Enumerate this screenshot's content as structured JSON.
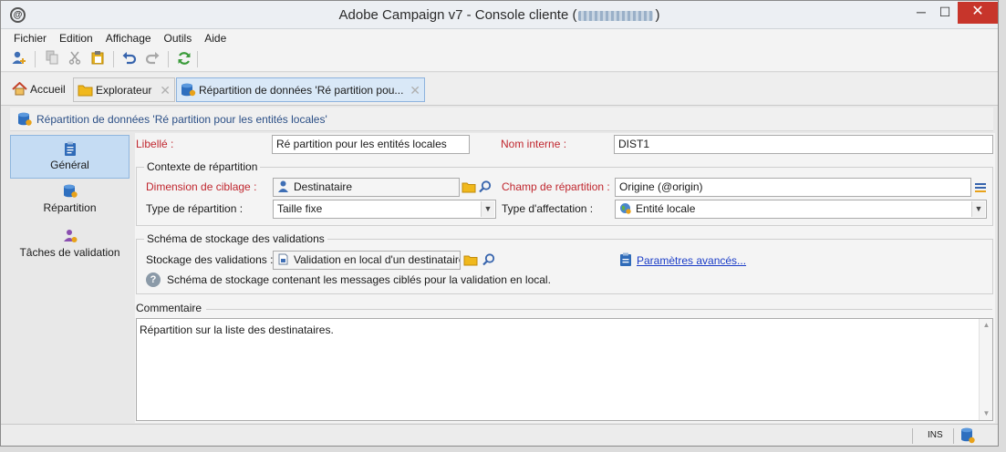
{
  "window": {
    "title_prefix": "Adobe Campaign v7 - Console cliente (",
    "title_suffix": ")",
    "controls": {
      "minimize": "─",
      "maximize": "☐",
      "close": "✕"
    }
  },
  "menu": [
    "Fichier",
    "Edition",
    "Affichage",
    "Outils",
    "Aide"
  ],
  "toolbar": {
    "icons": [
      "new-user-icon",
      "copy-icon",
      "cut-icon",
      "paste-icon",
      "undo-icon",
      "redo-icon",
      "refresh-icon"
    ]
  },
  "tabs": [
    {
      "label": "Accueil",
      "icon": "home-icon"
    },
    {
      "label": "Explorateur",
      "icon": "folder-icon",
      "close": "✕"
    },
    {
      "label": "Répartition de données 'Ré partition pou...",
      "icon": "database-icon",
      "close": "✕"
    }
  ],
  "breadcrumb": "Répartition de données 'Ré partition pour les entités locales'",
  "nav": {
    "general": "Général",
    "repartition": "Répartition",
    "taches": "Tâches de validation"
  },
  "form": {
    "libelle_label": "Libellé :",
    "libelle_value": "Ré partition pour les entités locales",
    "nom_interne_label": "Nom interne :",
    "nom_interne_value": "DIST1",
    "contexte_title": "Contexte de répartition",
    "dimension_label": "Dimension de ciblage :",
    "dimension_value": "Destinataire",
    "champ_label": "Champ de répartition :",
    "champ_value": "Origine (@origin)",
    "type_rep_label": "Type de répartition :",
    "type_rep_value": "Taille fixe",
    "type_aff_label": "Type d'affectation :",
    "type_aff_value": "Entité locale",
    "schema_title": "Schéma de stockage des validations",
    "stockage_label": "Stockage des validations :",
    "stockage_value": "Validation en local d'un destinataire",
    "parametres_link": "Paramètres avancés...",
    "help_text": "Schéma de stockage contenant les messages ciblés pour la validation en local.",
    "commentaire_label": "Commentaire",
    "commentaire_value": "Répartition sur la liste des destinataires."
  },
  "status": {
    "mode": "INS"
  },
  "colors": {
    "required_label": "#c0262e",
    "link": "#1a3cc7",
    "breadcrumb": "#2b4f86",
    "close_button": "#c7352b",
    "active_tab": "#d9e8f7"
  }
}
